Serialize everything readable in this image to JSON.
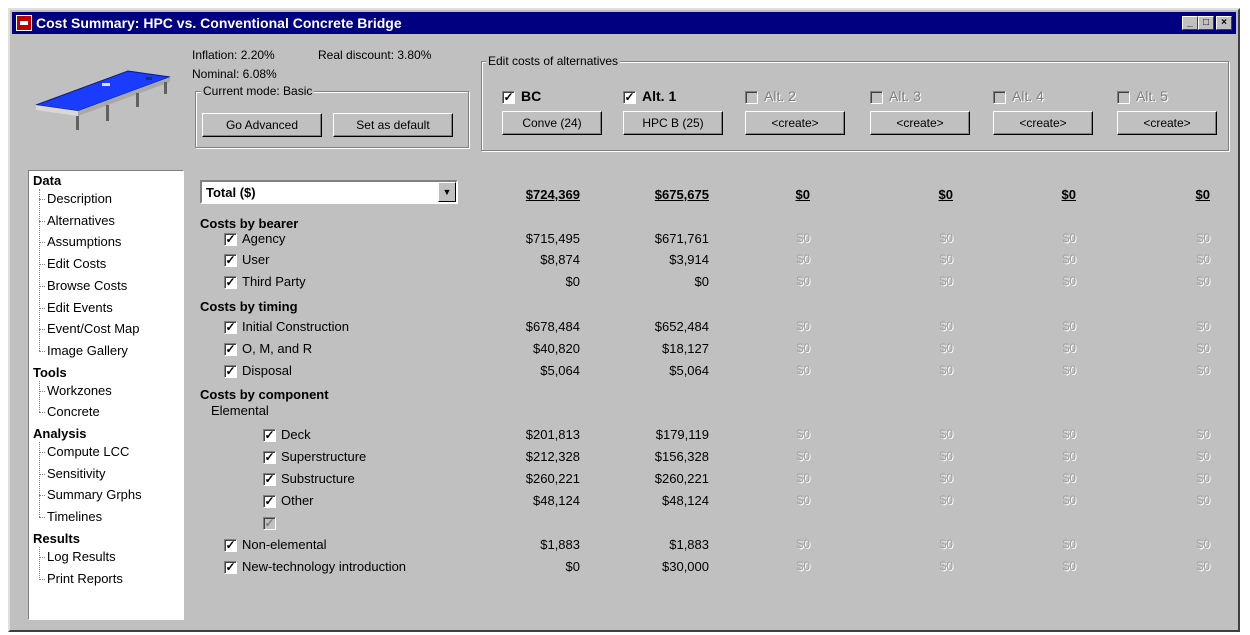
{
  "window": {
    "title": "Cost Summary: HPC vs. Conventional Concrete Bridge",
    "controls": {
      "minimize": "_",
      "maximize": "□",
      "close": "×"
    }
  },
  "params": {
    "inflation": "Inflation: 2.20%",
    "real_discount": "Real discount: 3.80%",
    "nominal": "Nominal: 6.08%"
  },
  "mode": {
    "group_label": "Current mode: Basic",
    "advanced_button": "Go Advanced",
    "default_button": "Set as default"
  },
  "alternatives": {
    "group_label": "Edit costs of alternatives",
    "items": [
      {
        "label": "BC",
        "checked": true,
        "enabled": true,
        "button": "Conve (24)"
      },
      {
        "label": "Alt. 1",
        "checked": true,
        "enabled": true,
        "button": "HPC B (25)"
      },
      {
        "label": "Alt. 2",
        "checked": false,
        "enabled": false,
        "button": "<create>"
      },
      {
        "label": "Alt. 3",
        "checked": false,
        "enabled": false,
        "button": "<create>"
      },
      {
        "label": "Alt. 4",
        "checked": false,
        "enabled": false,
        "button": "<create>"
      },
      {
        "label": "Alt. 5",
        "checked": false,
        "enabled": false,
        "button": "<create>"
      }
    ]
  },
  "nav": {
    "sections": [
      {
        "title": "Data",
        "items": [
          "Description",
          "Alternatives",
          "Assumptions",
          "Edit Costs",
          "Browse Costs",
          "Edit Events",
          "Event/Cost Map",
          "Image Gallery"
        ]
      },
      {
        "title": "Tools",
        "items": [
          "Workzones",
          "Concrete"
        ]
      },
      {
        "title": "Analysis",
        "items": [
          "Compute LCC",
          "Sensitivity",
          "Summary Grphs",
          "Timelines"
        ]
      },
      {
        "title": "Results",
        "items": [
          "Log Results",
          "Print Reports"
        ]
      }
    ]
  },
  "summary": {
    "selector_value": "Total ($)",
    "totals": [
      "$724,369",
      "$675,675",
      "$0",
      "$0",
      "$0",
      "$0"
    ],
    "sections": {
      "bearer": "Costs by bearer",
      "timing": "Costs by timing",
      "component": "Costs by component"
    },
    "elemental_label": "Elemental",
    "rows": {
      "agency": {
        "label": "Agency",
        "values": [
          "$715,495",
          "$671,761",
          "$0",
          "$0",
          "$0",
          "$0"
        ]
      },
      "user": {
        "label": "User",
        "values": [
          "$8,874",
          "$3,914",
          "$0",
          "$0",
          "$0",
          "$0"
        ]
      },
      "third_party": {
        "label": "Third Party",
        "values": [
          "$0",
          "$0",
          "$0",
          "$0",
          "$0",
          "$0"
        ]
      },
      "initial": {
        "label": "Initial Construction",
        "values": [
          "$678,484",
          "$652,484",
          "$0",
          "$0",
          "$0",
          "$0"
        ]
      },
      "omr": {
        "label": "O, M, and R",
        "values": [
          "$40,820",
          "$18,127",
          "$0",
          "$0",
          "$0",
          "$0"
        ]
      },
      "disposal": {
        "label": "Disposal",
        "values": [
          "$5,064",
          "$5,064",
          "$0",
          "$0",
          "$0",
          "$0"
        ]
      },
      "deck": {
        "label": "Deck",
        "values": [
          "$201,813",
          "$179,119",
          "$0",
          "$0",
          "$0",
          "$0"
        ]
      },
      "superstructure": {
        "label": "Superstructure",
        "values": [
          "$212,328",
          "$156,328",
          "$0",
          "$0",
          "$0",
          "$0"
        ]
      },
      "substructure": {
        "label": "Substructure",
        "values": [
          "$260,221",
          "$260,221",
          "$0",
          "$0",
          "$0",
          "$0"
        ]
      },
      "other": {
        "label": "Other",
        "values": [
          "$48,124",
          "$48,124",
          "$0",
          "$0",
          "$0",
          "$0"
        ]
      },
      "non_elemental": {
        "label": "Non-elemental",
        "values": [
          "$1,883",
          "$1,883",
          "$0",
          "$0",
          "$0",
          "$0"
        ]
      },
      "new_tech": {
        "label": "New-technology introduction",
        "values": [
          "$0",
          "$30,000",
          "$0",
          "$0",
          "$0",
          "$0"
        ]
      }
    }
  }
}
